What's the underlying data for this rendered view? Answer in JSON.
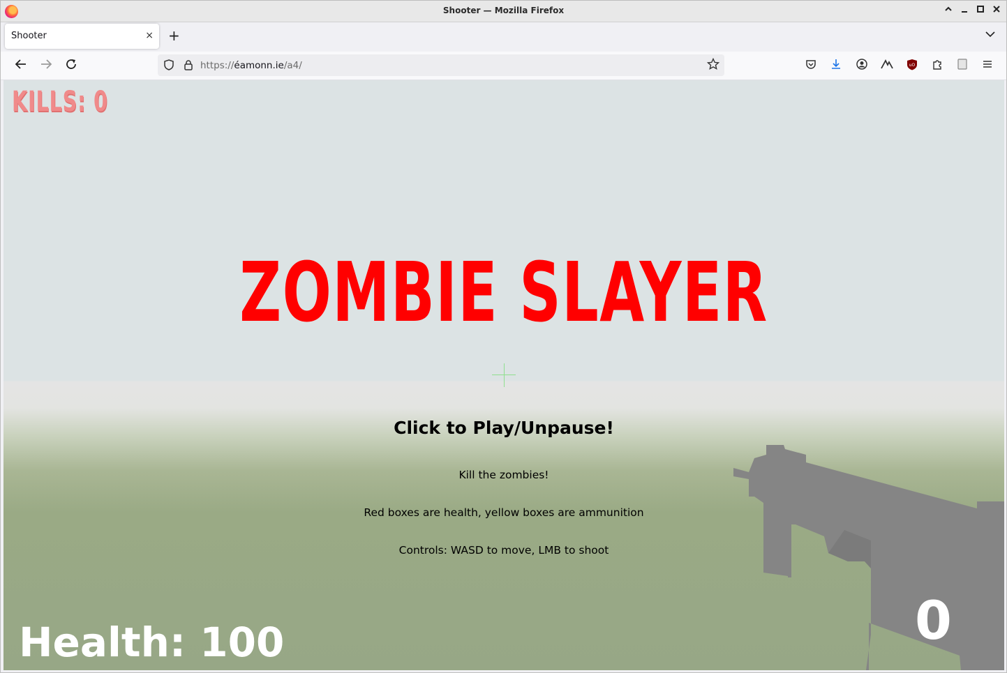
{
  "window": {
    "title": "Shooter — Mozilla Firefox"
  },
  "tab": {
    "title": "Shooter",
    "close": "×"
  },
  "newtab": "+",
  "address": {
    "scheme": "https://",
    "host": "éamonn.ie",
    "path": "/a4/"
  },
  "game": {
    "kills_label": "KILLS: 0",
    "title": "ZOMBIE SLAYER",
    "menu_heading": "Click to Play/Unpause!",
    "lines": [
      "Kill the zombies!",
      "Red boxes are health, yellow boxes are ammunition",
      "Controls: WASD to move, LMB to shoot"
    ],
    "health_label": "Health: 100",
    "ammo": "0",
    "colors": {
      "title": "#ff0000",
      "kills": "#f08a8a",
      "sky": "#dce3e4",
      "ground": "#97a786",
      "crosshair": "#8fe08f",
      "gun": "#858585"
    }
  },
  "icons": {
    "back": "back-arrow-icon",
    "forward": "forward-arrow-icon",
    "reload": "reload-icon",
    "pocket": "pocket-icon",
    "downloads": "download-icon",
    "account": "account-icon",
    "extension1": "extension-icon",
    "ublock": "ublock-icon",
    "extensions": "puzzle-icon",
    "reader": "reader-icon",
    "menu": "hamburger-menu-icon"
  }
}
